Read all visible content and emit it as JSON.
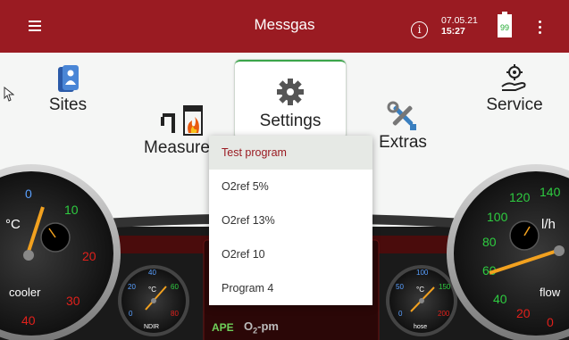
{
  "header": {
    "title": "Messgas",
    "info_symbol": "i",
    "date": "07.05.21",
    "time": "15:27",
    "battery_level": "99"
  },
  "tiles": {
    "sites": "Sites",
    "measure": "Measure",
    "settings": "Settings",
    "extras": "Extras",
    "service": "Service"
  },
  "menu": {
    "items": [
      "Test program",
      "O2ref 5%",
      "O2ref 13%",
      "O2ref 10",
      "Program 4"
    ],
    "selected_index": 0
  },
  "left_gauge": {
    "unit": "°C",
    "label": "cooler",
    "ticks": [
      "0",
      "10",
      "20",
      "30",
      "40"
    ]
  },
  "left_small_gauge": {
    "unit": "°C",
    "label": "NDIR",
    "ticks": [
      "20",
      "40",
      "60",
      "80",
      "0"
    ]
  },
  "right_small_gauge": {
    "unit": "°C",
    "label": "hose",
    "ticks": [
      "50",
      "100",
      "150",
      "200",
      "0"
    ]
  },
  "right_gauge": {
    "unit": "l/h",
    "label": "flow",
    "ticks": [
      "140",
      "120",
      "100",
      "80",
      "60",
      "40",
      "20",
      "0"
    ]
  },
  "bottom": {
    "ape": "APE",
    "o2_prefix": "O",
    "o2_sub": "2",
    "o2_suffix": "-pm"
  },
  "colors": {
    "brand": "#9a1b22",
    "accent_green": "#3ba54a",
    "gauge_green": "#2ecc40",
    "gauge_red": "#e0201b",
    "needle_orange": "#f2a11f"
  },
  "icons": {
    "menu": "hamburger-menu-icon",
    "info": "info-icon",
    "battery": "battery-icon",
    "more": "more-vert-icon",
    "sites": "sites-icon",
    "measure": "measure-icon",
    "settings": "gear-icon",
    "extras": "tools-icon",
    "service": "service-hand-gear-icon",
    "cursor": "mouse-cursor-icon"
  }
}
